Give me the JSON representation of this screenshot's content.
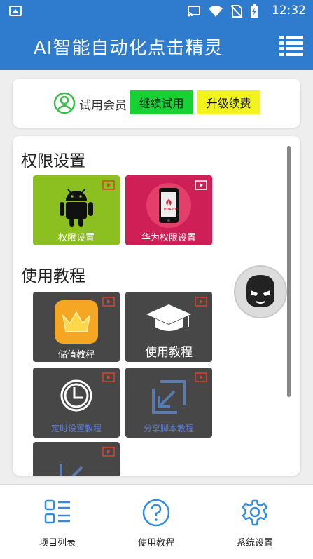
{
  "status_bar": {
    "time": "12:32"
  },
  "app_bar": {
    "title": "AI智能自动化点击精灵"
  },
  "member": {
    "label": "试用会员",
    "trial_button": "继续试用",
    "upgrade_button": "升级续费"
  },
  "sections": [
    {
      "title": "权限设置"
    },
    {
      "title": "使用教程"
    }
  ],
  "tiles": {
    "permission": {
      "label": "权限设置",
      "color": "#8cc020"
    },
    "huawei": {
      "label": "华为权限设置",
      "color": "#cf1f57",
      "brand": "HUAWEI"
    },
    "recharge": {
      "label": "储值教程"
    },
    "tutorial": {
      "label": "使用教程"
    },
    "timer": {
      "label": "定时设置教程"
    },
    "share": {
      "label": "分享脚本教程"
    }
  },
  "bottom_nav": {
    "items": [
      {
        "label": "项目列表"
      },
      {
        "label": "使用教程"
      },
      {
        "label": "系统设置"
      }
    ]
  },
  "colors": {
    "primary": "#2f7ccf",
    "trial": "#17d234",
    "upgrade": "#f3f31d",
    "dark_tile": "#474747"
  }
}
